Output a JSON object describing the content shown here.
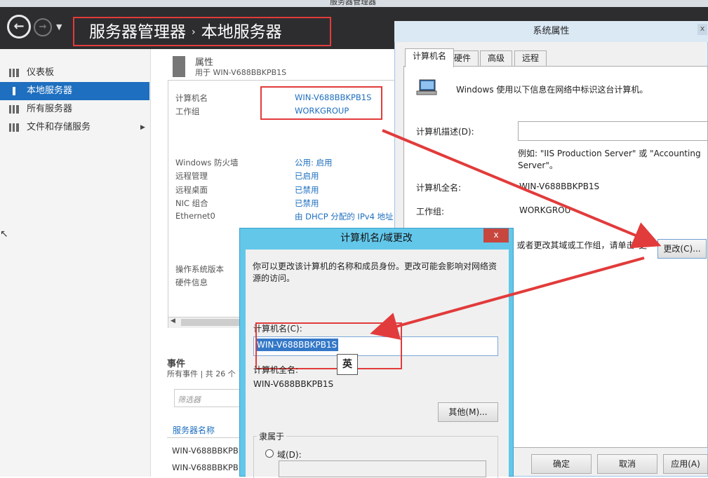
{
  "window": {
    "title": "服务器管理器"
  },
  "header": {
    "breadcrumb": {
      "root": "服务器管理器",
      "separator": "›",
      "current": "本地服务器"
    },
    "back_icon": "arrow-left-circle",
    "forward_icon": "arrow-right-circle",
    "dropdown_icon": "triangle-down"
  },
  "sidebar": {
    "items": [
      {
        "label": "仪表板",
        "icon": "dashboard-grid-icon"
      },
      {
        "label": "本地服务器",
        "icon": "server-icon",
        "active": true
      },
      {
        "label": "所有服务器",
        "icon": "servers-icon"
      },
      {
        "label": "文件和存储服务",
        "icon": "storage-icon",
        "chevron": "▶"
      }
    ]
  },
  "properties": {
    "title": "属性",
    "subtitle": "用于 WIN-V688BBKPB1S",
    "rows": [
      {
        "label": "计算机名",
        "value": "WIN-V688BBKPB1S"
      },
      {
        "label": "工作组",
        "value": "WORKGROUP"
      },
      {
        "label": "Windows 防火墙",
        "value": "公用: 启用"
      },
      {
        "label": "远程管理",
        "value": "已启用"
      },
      {
        "label": "远程桌面",
        "value": "已禁用"
      },
      {
        "label": "NIC 组合",
        "value": "已禁用"
      },
      {
        "label": "Ethernet0",
        "value": "由 DHCP 分配的 IPv4 地址"
      },
      {
        "label": "操作系统版本",
        "value": ""
      },
      {
        "label": "硬件信息",
        "value": ""
      }
    ]
  },
  "events": {
    "title": "事件",
    "subtitle": "所有事件 | 共 26 个",
    "filter_placeholder": "筛选器",
    "column_header": "服务器名称",
    "rows": [
      "WIN-V688BBKPB",
      "WIN-V688BBKPB"
    ]
  },
  "system_properties": {
    "title": "系统属性",
    "close_label": "x",
    "tabs": [
      "计算机名",
      "硬件",
      "高级",
      "远程"
    ],
    "intro": "Windows 使用以下信息在网络中标识这台计算机。",
    "description_label": "计算机描述(D):",
    "description_value": "",
    "example": "例如: \"IIS Production Server\" 或 \"Accounting Server\"。",
    "full_name_label": "计算机全名:",
    "full_name_value": "WIN-V688BBKPB1S",
    "workgroup_label": "工作组:",
    "workgroup_value": "WORKGROU",
    "change_text": "若要重命名这台计算机，或者更改其域或工作组，请单击\"更",
    "change_button": "更改(C)...",
    "ok_button": "确定",
    "cancel_button": "取消",
    "apply_button": "应用(A)"
  },
  "change_dialog": {
    "title": "计算机名/域更改",
    "close_label": "x",
    "intro": "你可以更改该计算机的名称和成员身份。更改可能会影响对网络资源的访问。",
    "computer_name_label": "计算机名(C):",
    "computer_name_value": "WIN-V688BBKPB1S",
    "full_name_label": "计算机全名:",
    "full_name_value": "WIN-V688BBKPB1S",
    "other_button": "其他(M)...",
    "member_of_label": "隶属于",
    "domain_label": "域(D):",
    "ime_indicator": "英"
  },
  "colors": {
    "accent": "#1e6fbf",
    "header_bg": "#2d2d30",
    "annotation_red": "#e23b3b",
    "dialog_frame": "#63c7ea"
  }
}
